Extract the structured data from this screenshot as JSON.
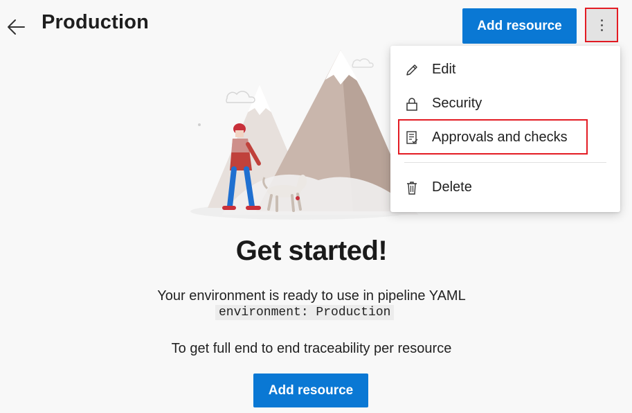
{
  "header": {
    "title": "Production",
    "add_resource_label": "Add resource"
  },
  "menu": {
    "items": [
      {
        "label": "Edit",
        "icon": "pencil-icon"
      },
      {
        "label": "Security",
        "icon": "lock-icon"
      },
      {
        "label": "Approvals and checks",
        "icon": "checklist-icon"
      },
      {
        "label": "Delete",
        "icon": "trash-icon"
      }
    ]
  },
  "main": {
    "heading": "Get started!",
    "ready_text": "Your environment is ready to use in pipeline YAML",
    "code_snippet": "environment: Production",
    "trace_text": "To get full end to end traceability per resource",
    "add_resource_label": "Add resource"
  },
  "colors": {
    "primary": "#0a78d4",
    "highlight": "#e31b23"
  }
}
